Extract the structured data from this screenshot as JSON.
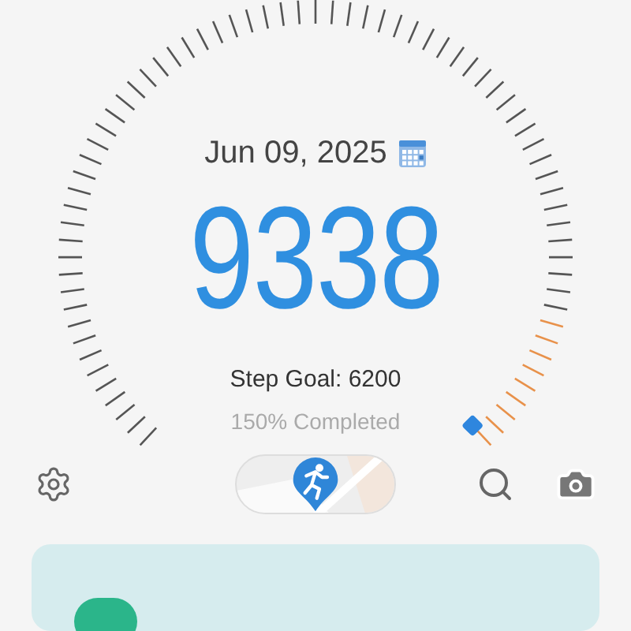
{
  "date": "Jun 09, 2025",
  "steps": "9338",
  "goal": "Step Goal: 6200",
  "progress": "150% Completed",
  "toolbar": {
    "map_toggle": {
      "on": true
    }
  }
}
